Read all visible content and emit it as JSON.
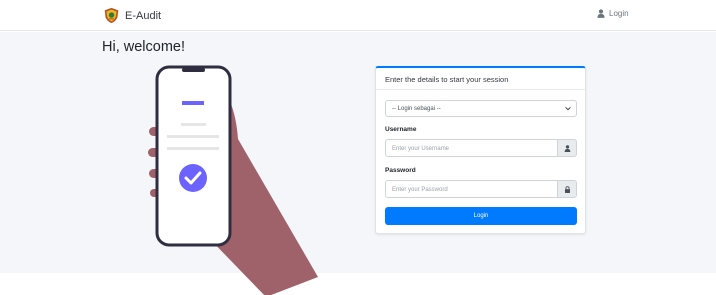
{
  "navbar": {
    "brand_text": "E-Audit",
    "login_label": "Login"
  },
  "main": {
    "welcome": "Hi, welcome!"
  },
  "login_card": {
    "header": "Enter the details to start your session",
    "select": {
      "selected": "-- Login sebagai --"
    },
    "username_label": "Username",
    "username_placeholder": "Enter your Username",
    "password_label": "Password",
    "password_placeholder": "Enter your Password",
    "submit_label": "Login"
  },
  "icons": {
    "brand": "crest-logo",
    "nav_login": "user-icon",
    "username_addon": "user-icon",
    "password_addon": "lock-icon",
    "select": "chevron-down-icon",
    "illustration_check": "check-icon"
  },
  "colors": {
    "primary": "#007bff",
    "background": "#f4f6f9",
    "illustration_accent": "#6c63ff",
    "illustration_arm": "#a0626a"
  }
}
